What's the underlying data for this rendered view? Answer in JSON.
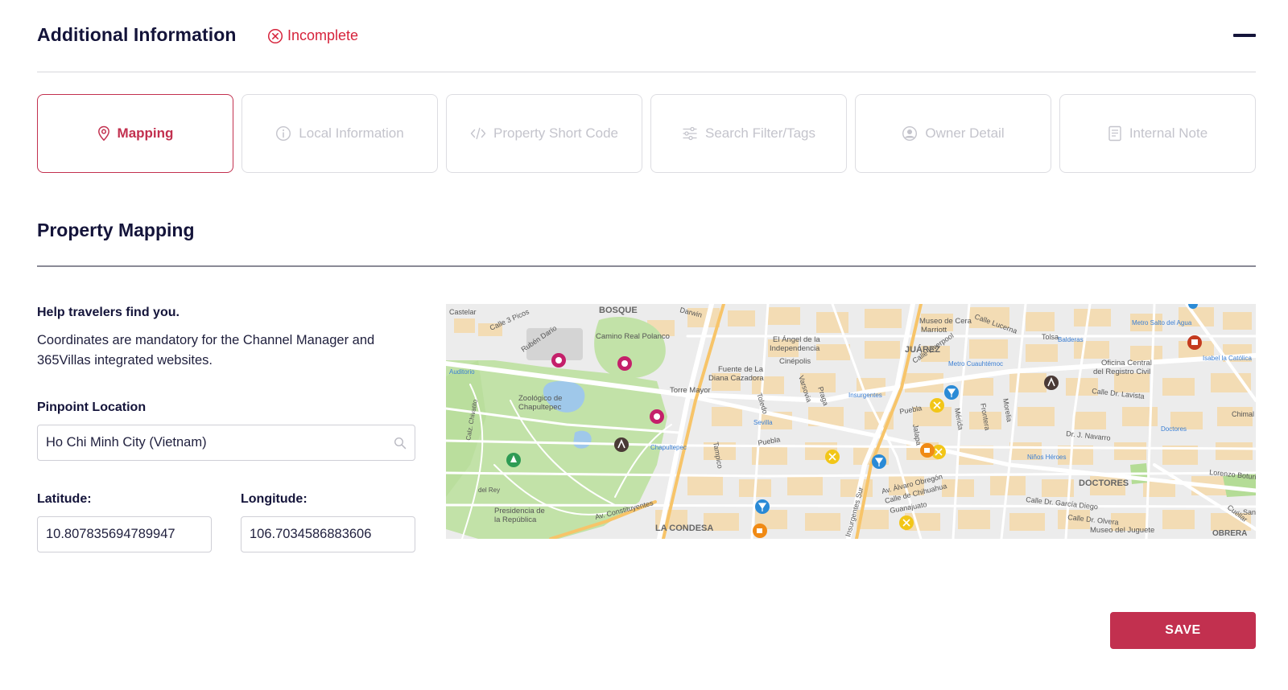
{
  "header": {
    "title": "Additional Information",
    "status_label": "Incomplete"
  },
  "tabs": [
    {
      "label": "Mapping",
      "icon": "map-pin-icon",
      "active": true
    },
    {
      "label": "Local Information",
      "icon": "info-icon",
      "active": false
    },
    {
      "label": "Property Short Code",
      "icon": "code-icon",
      "active": false
    },
    {
      "label": "Search Filter/Tags",
      "icon": "sliders-icon",
      "active": false
    },
    {
      "label": "Owner Detail",
      "icon": "user-circle-icon",
      "active": false
    },
    {
      "label": "Internal Note",
      "icon": "note-icon",
      "active": false
    }
  ],
  "section": {
    "title": "Property Mapping"
  },
  "help": {
    "title": "Help travelers find you.",
    "description": "Coordinates are mandatory for the Channel Manager and 365Villas integrated websites."
  },
  "pinpoint": {
    "label": "Pinpoint Location",
    "value": "Ho Chi Minh City (Vietnam)"
  },
  "latitude": {
    "label": "Latitude:",
    "value": "10.807835694789947"
  },
  "longitude": {
    "label": "Longitude:",
    "value": "106.7034586883606"
  },
  "map_labels": {
    "bosque": "BOSQUE",
    "juarez": "JUÁREZ",
    "condesa": "LA CONDESA",
    "doctores": "DOCTORES",
    "obrera": "OBRERA",
    "camino_real": "Camino Real Polanco",
    "angel_1": "El Ángel de la",
    "angel_2": "Independencia",
    "cinepolis": "Cinépolis",
    "marriott": "Marriott",
    "museo_cera": "Museo de Cera",
    "fuente_1": "Fuente de La",
    "fuente_2": "Diana Cazadora",
    "torre": "Torre Mayor",
    "zoo_1": "Zoológico de",
    "zoo_2": "Chapultepec",
    "presidencia_1": "Presidencia de",
    "presidencia_2": "la República",
    "oficina_1": "Oficina Central",
    "oficina_2": "del Registro Civil",
    "museo_juguete": "Museo del Juguete",
    "av_const": "Av. Constituyentes",
    "insurgentes_sur": "Insurgentes Sur",
    "alvaro": "Av. Álvaro Obregón",
    "chihuahua": "Calle de Chihuahua",
    "guanajuato": "Guanajuato",
    "liverpool": "Calle Liverpool",
    "lucerna": "Calle Lucerna",
    "lavista": "Calle Dr. Lavista",
    "navarro": "Dr. J. Navarro",
    "garcia": "Calle Dr. García Diego",
    "olvera": "Calle Dr. Olvera",
    "lorenzo": "Lorenzo Boturini",
    "castelar": "Castelar",
    "darwin": "Darwin",
    "picos": "Calle 3 Picos",
    "ruben": "Rubén Darío",
    "auditorio": "Auditorio",
    "chapultepec_m": "Chapultepec",
    "sevilla": "Sevilla",
    "insurgentes_m": "Insurgentes",
    "cuauhtemoc": "Metro Cuauhtémoc",
    "balderas": "Balderas",
    "salto": "Metro Salto del Agua",
    "isabel": "Isabel la Católica",
    "doctores_m": "Doctores",
    "ninos": "Niños Héroes",
    "puebla": "Puebla",
    "jalapa": "Jalapa",
    "merida": "Mérida",
    "frontera": "Frontera",
    "morelia": "Morelia",
    "toledo": "Toledo",
    "varsovia": "Varsovia",
    "praga": "Praga",
    "tampico": "Tampico",
    "tolsa": "Tolsa",
    "chimal": "Chimal",
    "rey": "del Rey",
    "calz": "Calz. Chivatito",
    "cuellar": "Cuéllar",
    "san": "San"
  },
  "actions": {
    "save_label": "SAVE"
  },
  "colors": {
    "brand": "#c2304f",
    "status_error": "#d6233b",
    "heading": "#14143a",
    "park": "#bfe0a4",
    "block": "#f3dcb4"
  }
}
